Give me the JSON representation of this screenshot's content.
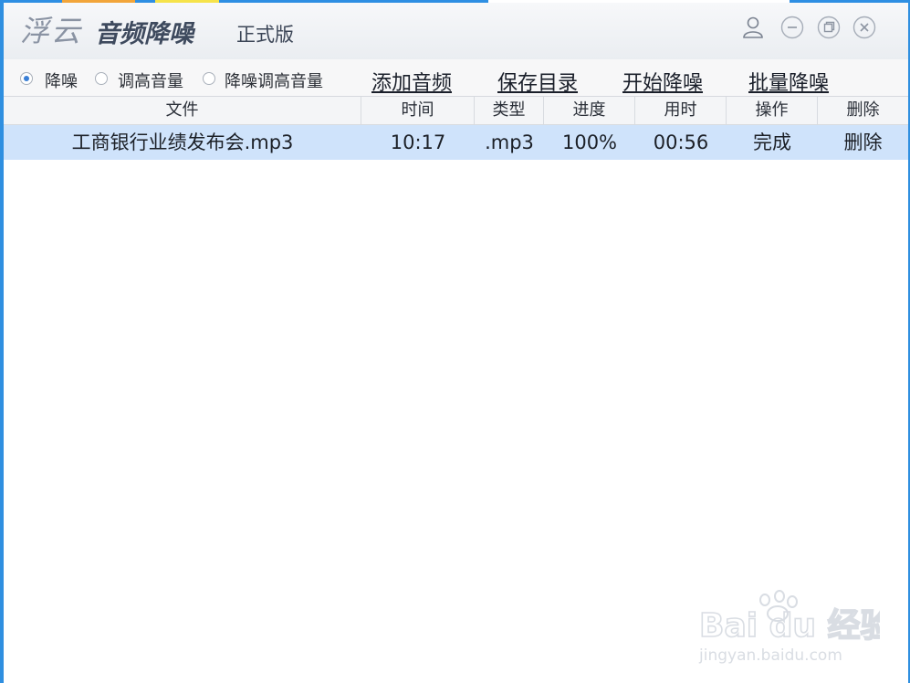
{
  "titlebar": {
    "brand_name": "浮云",
    "product_name": "音频降噪",
    "edition": "正式版",
    "icons": [
      "user-icon",
      "minimize-icon",
      "maximize-icon",
      "close-icon"
    ]
  },
  "toolbar": {
    "modes": [
      {
        "label": "降噪",
        "selected": true
      },
      {
        "label": "调高音量",
        "selected": false
      },
      {
        "label": "降噪调高音量",
        "selected": false
      }
    ],
    "actions": [
      "添加音频",
      "保存目录",
      "开始降噪",
      "批量降噪"
    ]
  },
  "table": {
    "columns": [
      "文件",
      "时间",
      "类型",
      "进度",
      "用时",
      "操作",
      "删除"
    ],
    "rows": [
      {
        "file": "工商银行业绩发布会.mp3",
        "time": "10:17",
        "type": ".mp3",
        "progress": "100%",
        "used": "00:56",
        "op": "完成",
        "del": "删除"
      }
    ]
  },
  "watermark": {
    "brand": "Bai du 经验",
    "url": "jingyan.baidu.com"
  },
  "colors": {
    "selected_row": "#cfe3fb",
    "accent": "#3a7fd6",
    "frame": "#2f8fe0"
  }
}
